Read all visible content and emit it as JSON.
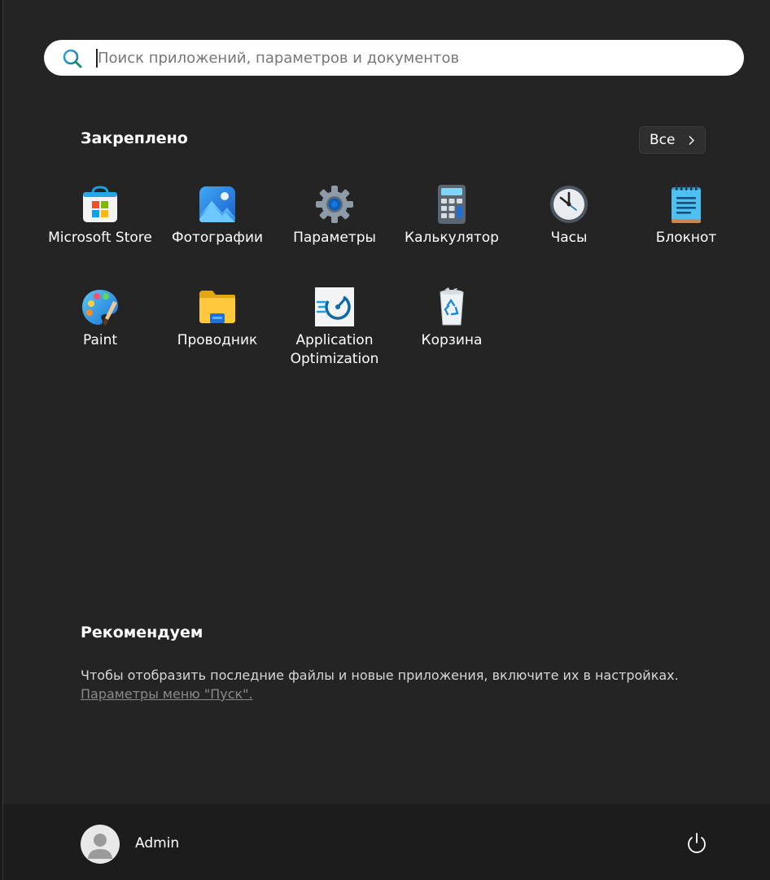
{
  "search": {
    "placeholder": "Поиск приложений, параметров и документов",
    "value": ""
  },
  "pinned": {
    "title": "Закреплено",
    "all_button_label": "Все",
    "apps": [
      {
        "label": "Microsoft Store",
        "icon": "microsoft-store-icon"
      },
      {
        "label": "Фотографии",
        "icon": "photos-icon"
      },
      {
        "label": "Параметры",
        "icon": "settings-gear-icon"
      },
      {
        "label": "Калькулятор",
        "icon": "calculator-icon"
      },
      {
        "label": "Часы",
        "icon": "clock-icon"
      },
      {
        "label": "Блокнот",
        "icon": "notepad-icon"
      },
      {
        "label": "Paint",
        "icon": "paint-palette-icon"
      },
      {
        "label": "Проводник",
        "icon": "folder-icon"
      },
      {
        "label": "Application Optimization",
        "icon": "app-optimization-icon"
      },
      {
        "label": "Корзина",
        "icon": "recycle-bin-icon"
      }
    ]
  },
  "recommended": {
    "title": "Рекомендуем",
    "message": "Чтобы отобразить последние файлы и новые приложения, включите их в настройках.",
    "link_label": "Параметры меню \"Пуск\"."
  },
  "footer": {
    "user_name": "Admin"
  },
  "colors": {
    "background": "#242424",
    "footer": "#1c1c1c",
    "search_bg": "#ffffff",
    "accent": "#0a6fc2"
  }
}
